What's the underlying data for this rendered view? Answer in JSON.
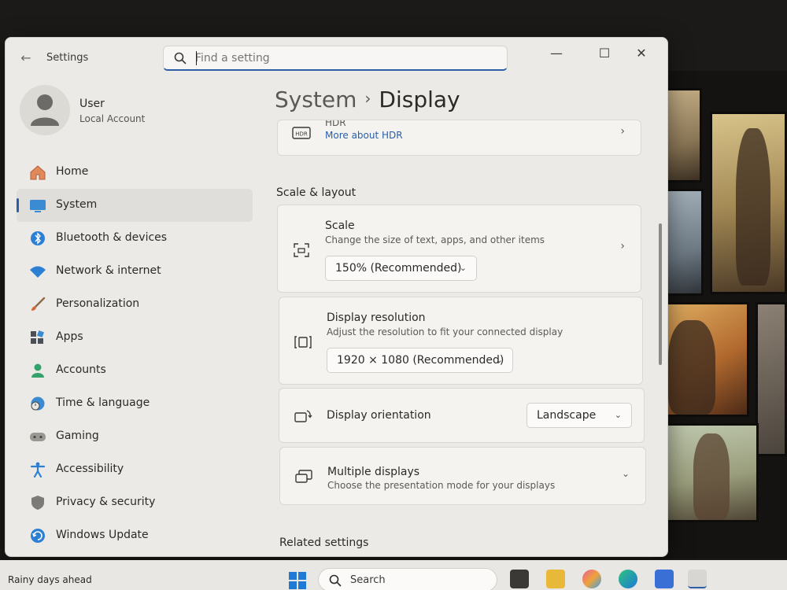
{
  "window": {
    "app_title": "Settings"
  },
  "search": {
    "placeholder": "Find a setting"
  },
  "profile": {
    "name": "User",
    "account_type": "Local Account"
  },
  "sidebar": {
    "items": [
      {
        "label": "Home",
        "icon": "home-icon"
      },
      {
        "label": "System",
        "icon": "monitor-icon",
        "active": true
      },
      {
        "label": "Bluetooth & devices",
        "icon": "bluetooth-icon"
      },
      {
        "label": "Network & internet",
        "icon": "wifi-icon"
      },
      {
        "label": "Personalization",
        "icon": "brush-icon"
      },
      {
        "label": "Apps",
        "icon": "apps-icon"
      },
      {
        "label": "Accounts",
        "icon": "person-icon"
      },
      {
        "label": "Time & language",
        "icon": "globe-clock-icon"
      },
      {
        "label": "Gaming",
        "icon": "gamepad-icon"
      },
      {
        "label": "Accessibility",
        "icon": "accessibility-icon"
      },
      {
        "label": "Privacy & security",
        "icon": "shield-icon"
      },
      {
        "label": "Windows Update",
        "icon": "update-icon"
      }
    ]
  },
  "breadcrumb": {
    "parent": "System",
    "current": "Display"
  },
  "hdr": {
    "title": "HDR",
    "link": "More about HDR"
  },
  "scale_layout": {
    "heading": "Scale & layout",
    "scale": {
      "title": "Scale",
      "description": "Change the size of text, apps, and other items",
      "value": "150% (Recommended)"
    },
    "resolution": {
      "title": "Display resolution",
      "description": "Adjust the resolution to fit your connected display",
      "value": "1920 × 1080 (Recommended)"
    },
    "orientation": {
      "title": "Display orientation",
      "value": "Landscape"
    },
    "multiple": {
      "title": "Multiple displays",
      "description": "Choose the presentation mode for your displays"
    }
  },
  "related": {
    "heading": "Related settings"
  },
  "taskbar": {
    "weather": "Rainy days ahead",
    "search_label": "Search"
  },
  "colors": {
    "accent": "#2f5ea8",
    "window_bg": "#eceae6",
    "card_bg": "#f4f3f0"
  }
}
